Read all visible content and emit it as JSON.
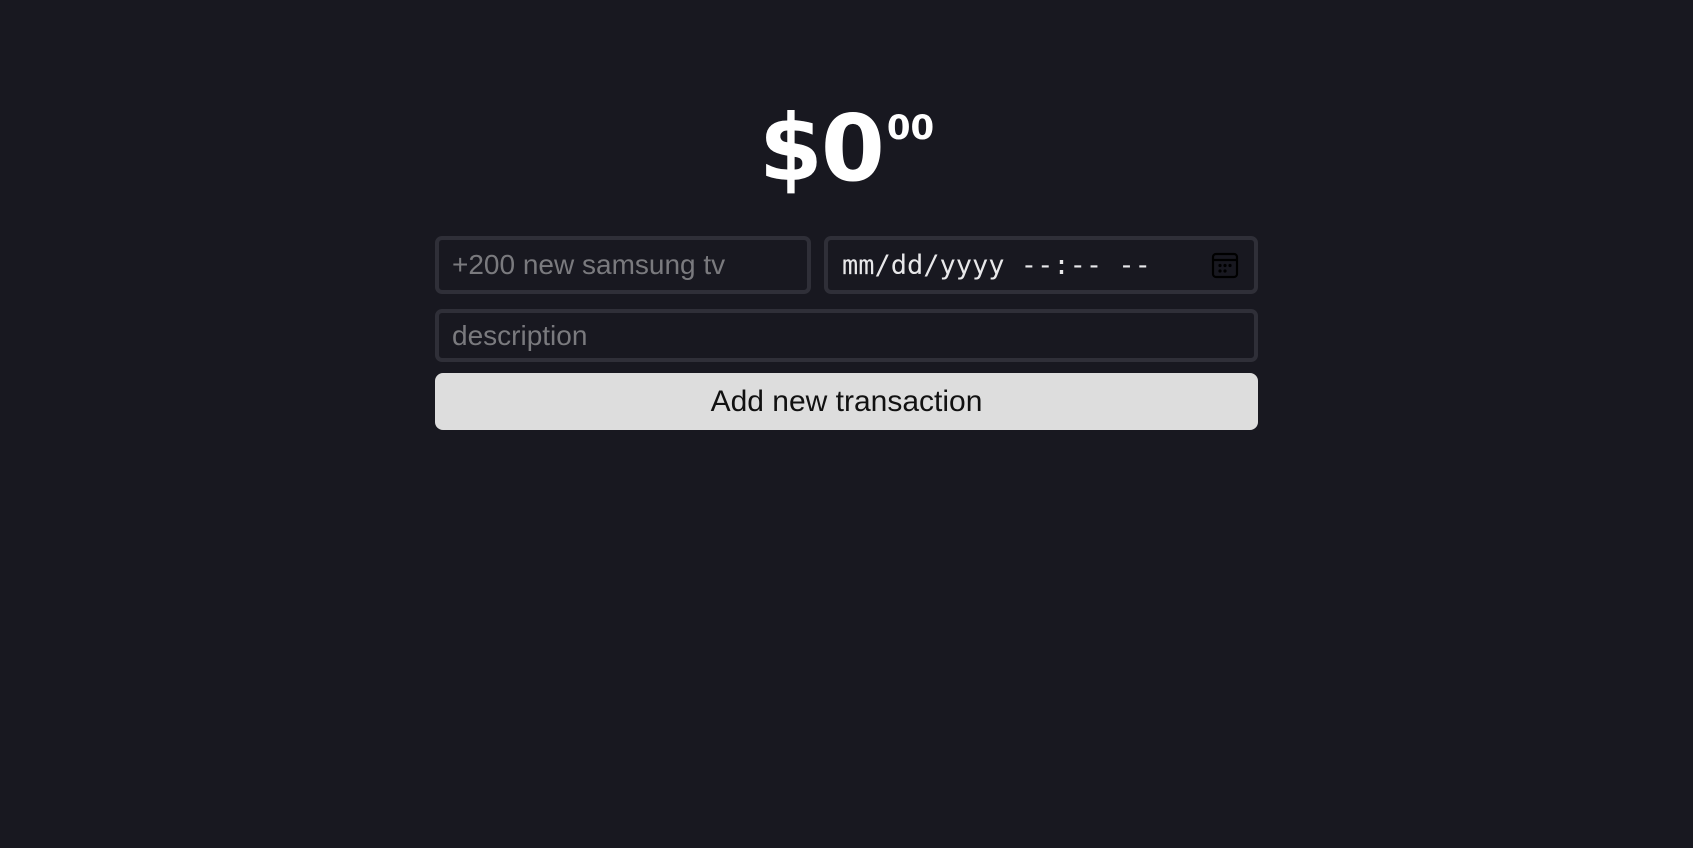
{
  "balance": {
    "whole": "$0",
    "cents": "00"
  },
  "form": {
    "price_placeholder": "+200 new samsung tv",
    "datetime_display": "mm/dd/yyyy --:-- --",
    "datetime_icon": "calendar-icon",
    "description_placeholder": "description",
    "submit_label": "Add new transaction"
  },
  "colors": {
    "background": "#181820",
    "field_border": "#2f2f38",
    "button_bg": "#dddddd",
    "text": "#ffffff",
    "placeholder": "#7a7a7e"
  }
}
